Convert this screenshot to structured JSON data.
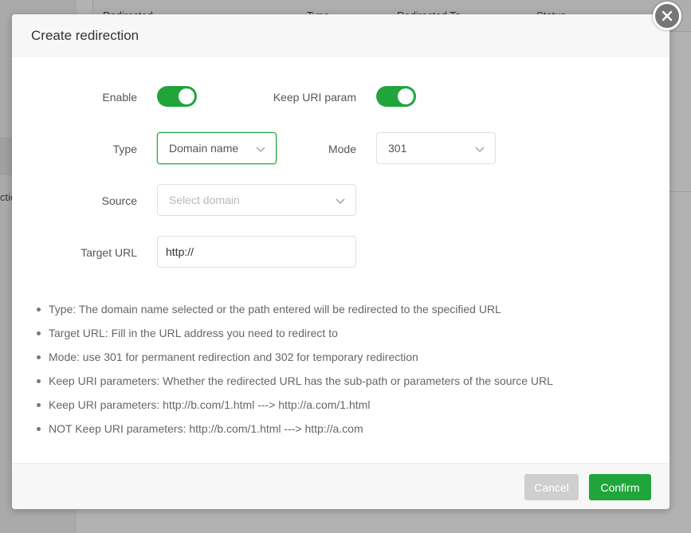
{
  "background": {
    "table_headers": [
      "Redirected",
      "Type",
      "Redirected To",
      "Status"
    ],
    "sidebar_fragment": "ctic"
  },
  "modal": {
    "title": "Create redirection",
    "fields": {
      "enable_label": "Enable",
      "enable_on": true,
      "keep_uri_label": "Keep URI param",
      "keep_uri_on": true,
      "type_label": "Type",
      "type_value": "Domain name",
      "mode_label": "Mode",
      "mode_value": "301",
      "source_label": "Source",
      "source_placeholder": "Select domain",
      "target_label": "Target URL",
      "target_value": "http://"
    },
    "help_items": [
      "Type: The domain name selected or the path entered will be redirected to the specified URL",
      "Target URL: Fill in the URL address you need to redirect to",
      "Mode: use 301 for permanent redirection and 302 for temporary redirection",
      "Keep URI parameters: Whether the redirected URL has the sub-path or parameters of the source URL",
      "Keep URI parameters: http://b.com/1.html ---> http://a.com/1.html",
      "NOT Keep URI parameters: http://b.com/1.html ---> http://a.com"
    ],
    "cancel_label": "Cancel",
    "confirm_label": "Confirm"
  },
  "colors": {
    "accent": "#20a53a",
    "cancel_bg": "#cfcfcf"
  },
  "icons": {
    "close": "close-icon",
    "chevron": "chevron-down-icon"
  }
}
